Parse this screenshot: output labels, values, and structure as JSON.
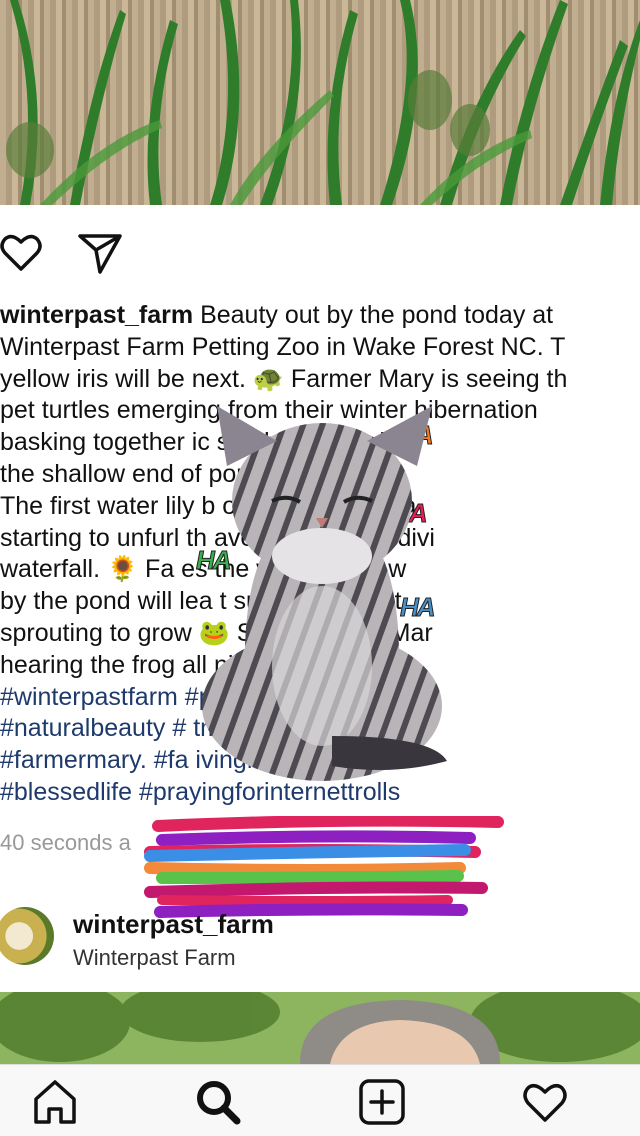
{
  "post": {
    "username": "winterpast_farm",
    "caption_lines": [
      " Beauty out by the pond today at",
      "Winterpast Farm Petting Zoo in Wake Forest NC. T",
      "yellow iris will be next. 🐢 Farmer Mary is seeing th",
      "pet turtles emerging from their winter hibernation",
      "basking together          ic      she has placed",
      "the shallow end of              pond conversion.",
      "The first water lily b          o      The banana pla",
      "starting to unfurl th           aves behind the divi",
      "waterfall. 🌻 Fa              es the wild rabbits w",
      "by the pond will lea           t      sunflowers that",
      "sprouting to grow             🐸 Soon Farmer Mar",
      "hearing the frog               all night."
    ],
    "hashtag_lines": [
      "#winterpastfarm                      #purpleflower",
      "#naturalbeauty #                      tmoreglowers",
      "#farmermary. #fa                      ivingmydream",
      "#blessedlife #prayingforinternettrolls"
    ],
    "timestamp": "40 seconds a"
  },
  "author": {
    "name": "winterpast_farm",
    "subtitle": "Winterpast Farm"
  },
  "stickers": {
    "ha_text": "HA"
  },
  "nav": {
    "items": [
      "home-icon",
      "search-icon",
      "add-post-icon",
      "activity-heart-icon"
    ]
  }
}
